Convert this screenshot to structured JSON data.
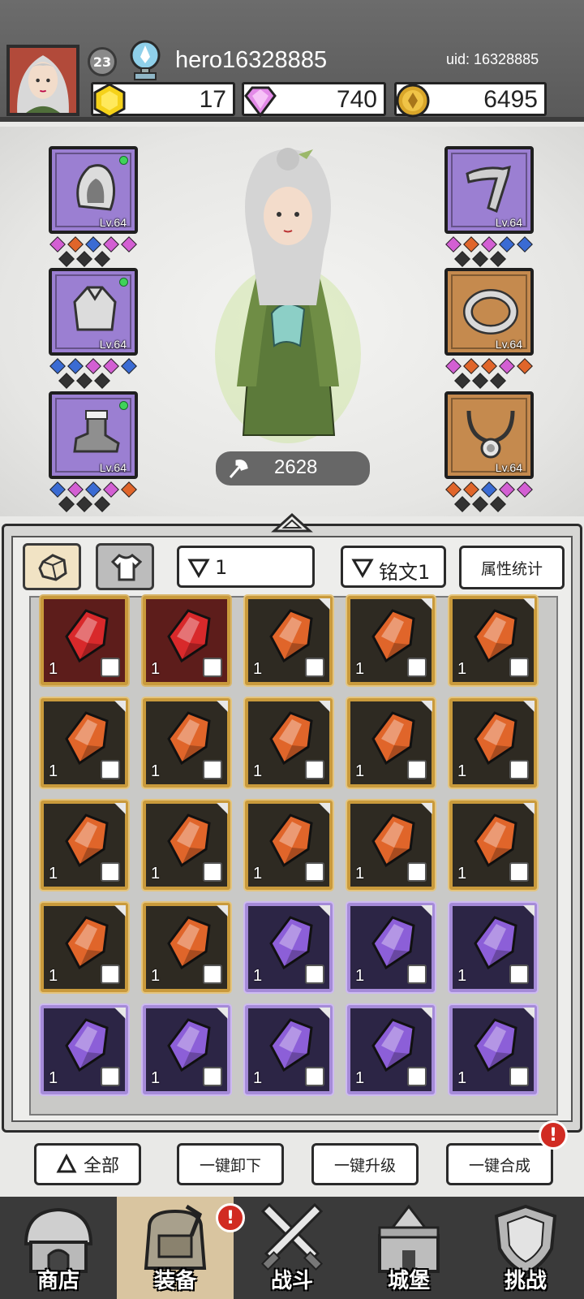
{
  "header": {
    "level": "23",
    "username": "hero16328885",
    "uid": "uid: 16328885",
    "currencies": [
      {
        "name": "gold-gem",
        "value": "17",
        "color": "#f5d21a"
      },
      {
        "name": "diamond",
        "value": "740",
        "color": "#e38ae8"
      },
      {
        "name": "coin",
        "value": "6495",
        "color": "#d9a62a"
      }
    ]
  },
  "equipment": {
    "left": [
      {
        "item": "hood",
        "level": "Lv.64",
        "rarity": "purple"
      },
      {
        "item": "cloak",
        "level": "Lv.64",
        "rarity": "purple"
      },
      {
        "item": "boot",
        "level": "Lv.64",
        "rarity": "purple"
      }
    ],
    "right": [
      {
        "item": "weapon",
        "level": "Lv.64",
        "rarity": "purple"
      },
      {
        "item": "ring",
        "level": "Lv.64",
        "rarity": "orange"
      },
      {
        "item": "necklace",
        "level": "Lv.64",
        "rarity": "orange"
      }
    ],
    "power": "2628"
  },
  "inventory": {
    "filter_value": "1",
    "rune_filter": "铭文1",
    "stats_label": "属性统计",
    "cells": [
      {
        "rarity": "red",
        "count": "1",
        "slot": "ring"
      },
      {
        "rarity": "red",
        "count": "1",
        "slot": "boot"
      },
      {
        "rarity": "orange",
        "count": "1",
        "slot": "ring"
      },
      {
        "rarity": "orange",
        "count": "1",
        "slot": "ring"
      },
      {
        "rarity": "orange",
        "count": "1",
        "slot": "ring"
      },
      {
        "rarity": "orange",
        "count": "1",
        "slot": "cloak"
      },
      {
        "rarity": "orange",
        "count": "1",
        "slot": "cloak"
      },
      {
        "rarity": "orange",
        "count": "1",
        "slot": "cloak"
      },
      {
        "rarity": "orange",
        "count": "1",
        "slot": "cloak"
      },
      {
        "rarity": "orange",
        "count": "1",
        "slot": "boot"
      },
      {
        "rarity": "orange",
        "count": "1",
        "slot": "weapon"
      },
      {
        "rarity": "orange",
        "count": "1",
        "slot": "weapon"
      },
      {
        "rarity": "orange",
        "count": "1",
        "slot": "weapon"
      },
      {
        "rarity": "orange",
        "count": "1",
        "slot": "weapon"
      },
      {
        "rarity": "orange",
        "count": "1",
        "slot": "hood"
      },
      {
        "rarity": "orange",
        "count": "1",
        "slot": "hood"
      },
      {
        "rarity": "orange",
        "count": "1",
        "slot": "necklace"
      },
      {
        "rarity": "purple",
        "count": "1",
        "slot": "ring"
      },
      {
        "rarity": "purple",
        "count": "1",
        "slot": "ring"
      },
      {
        "rarity": "purple",
        "count": "1",
        "slot": "ring"
      },
      {
        "rarity": "purple",
        "count": "1",
        "slot": "ring"
      },
      {
        "rarity": "purple",
        "count": "1",
        "slot": "cloak"
      },
      {
        "rarity": "purple",
        "count": "1",
        "slot": "cloak"
      },
      {
        "rarity": "purple",
        "count": "1",
        "slot": "boot"
      },
      {
        "rarity": "purple",
        "count": "1",
        "slot": "boot"
      }
    ]
  },
  "actions": {
    "all": "全部",
    "unequip_all": "一键卸下",
    "upgrade_all": "一键升级",
    "merge_all": "一键合成",
    "alert": "!"
  },
  "nav": [
    {
      "label": "商店",
      "icon": "shop-icon"
    },
    {
      "label": "装备",
      "icon": "equipment-bag-icon"
    },
    {
      "label": "战斗",
      "icon": "battle-swords-icon"
    },
    {
      "label": "城堡",
      "icon": "castle-icon"
    },
    {
      "label": "挑战",
      "icon": "challenge-shield-icon"
    }
  ],
  "colors": {
    "red_gem": "#d8292b",
    "orange_gem": "#e0652a",
    "purple_gem": "#8c5fd8"
  }
}
